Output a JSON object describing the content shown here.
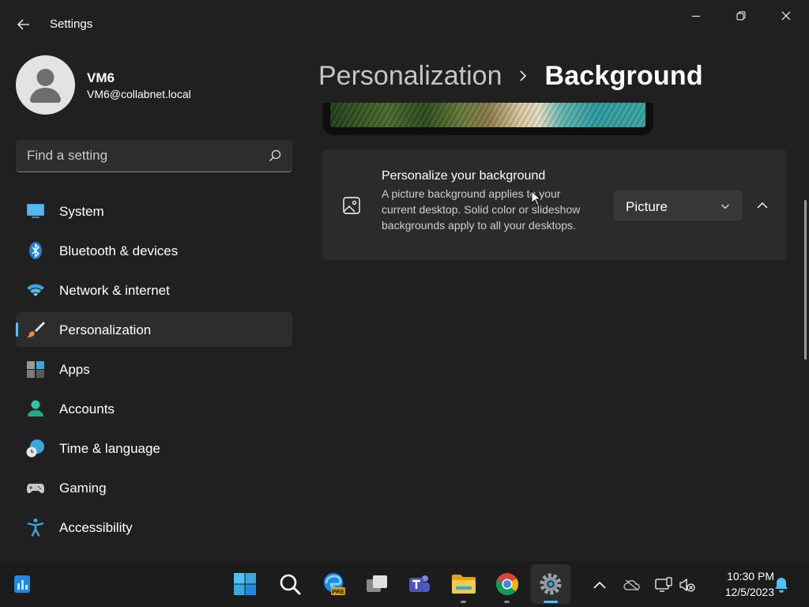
{
  "window": {
    "title": "Settings"
  },
  "profile": {
    "name": "VM6",
    "email": "VM6@collabnet.local"
  },
  "search": {
    "placeholder": "Find a setting"
  },
  "sidebar": {
    "items": [
      {
        "label": "System",
        "icon": "system-icon",
        "selected": false
      },
      {
        "label": "Bluetooth & devices",
        "icon": "bluetooth-icon",
        "selected": false
      },
      {
        "label": "Network & internet",
        "icon": "wifi-icon",
        "selected": false
      },
      {
        "label": "Personalization",
        "icon": "brush-icon",
        "selected": true
      },
      {
        "label": "Apps",
        "icon": "apps-icon",
        "selected": false
      },
      {
        "label": "Accounts",
        "icon": "accounts-icon",
        "selected": false
      },
      {
        "label": "Time & language",
        "icon": "globe-clock-icon",
        "selected": false
      },
      {
        "label": "Gaming",
        "icon": "gamepad-icon",
        "selected": false
      },
      {
        "label": "Accessibility",
        "icon": "accessibility-icon",
        "selected": false
      }
    ]
  },
  "breadcrumb": {
    "parent": "Personalization",
    "current": "Background"
  },
  "background_card": {
    "title": "Personalize your background",
    "description": "A picture background applies to your current desktop. Solid color or slideshow backgrounds apply to all your desktops.",
    "dropdown_value": "Picture",
    "icon": "image-icon"
  },
  "taskbar": {
    "clock_time": "10:30 PM",
    "clock_date": "12/5/2023",
    "edge_badge": "PRE"
  },
  "colors": {
    "accent": "#4cc2ff",
    "background": "#202020",
    "card": "#2b2b2b"
  }
}
